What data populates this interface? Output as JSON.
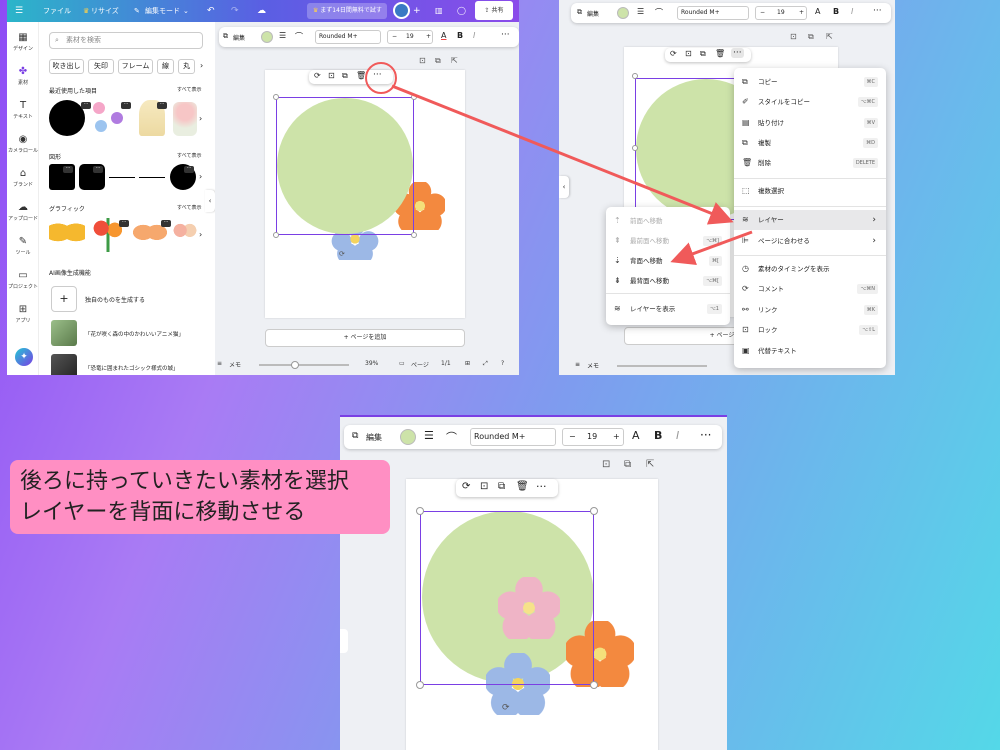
{
  "panel1": {
    "topbar": {
      "file": "ファイル",
      "resize": "リサイズ",
      "edit_mode": "編集モード",
      "trial": "まず14日間無料で試す",
      "share": "共有"
    },
    "sidebar": [
      {
        "icon": "design-icon",
        "label": "デザイン"
      },
      {
        "icon": "elements-icon",
        "label": "素材"
      },
      {
        "icon": "text-icon",
        "label": "テキスト"
      },
      {
        "icon": "camera-roll-icon",
        "label": "カメラロール"
      },
      {
        "icon": "brand-icon",
        "label": "ブランド"
      },
      {
        "icon": "upload-icon",
        "label": "アップロード"
      },
      {
        "icon": "draw-icon",
        "label": "ツール"
      },
      {
        "icon": "folder-icon",
        "label": "プロジェクト"
      },
      {
        "icon": "apps-icon",
        "label": "アプリ"
      }
    ],
    "search_placeholder": "素材を検索",
    "chips": [
      "吹き出し",
      "矢印",
      "フレーム",
      "線",
      "丸"
    ],
    "recent_title": "最近使用した項目",
    "see_all": "すべて表示",
    "shapes_title": "図形",
    "graphics_title": "グラフィック",
    "ai_title": "AI画像生成機能",
    "ai_generate": "独自のものを生成する",
    "ai_items": [
      "「花が咲く森の中のかわいいアニメ猫」",
      "「恐竜に囲まれたゴシック様式の城」"
    ],
    "toolbar": {
      "edit": "編集",
      "font": "Rounded M+",
      "size": "19"
    },
    "add_page": "+ ページを追加",
    "bottom": {
      "memo": "メモ",
      "zoom": "39%",
      "page": "ページ",
      "page_count": "1/1"
    }
  },
  "panel2": {
    "toolbar": {
      "edit": "編集",
      "font": "Rounded M+",
      "size": "19"
    },
    "context_menu": [
      {
        "icon": "copy-icon",
        "label": "コピー",
        "shortcut": "⌘C"
      },
      {
        "icon": "copy-style-icon",
        "label": "スタイルをコピー",
        "shortcut": "⌥⌘C"
      },
      {
        "icon": "paste-icon",
        "label": "貼り付け",
        "shortcut": "⌘V"
      },
      {
        "icon": "duplicate-icon",
        "label": "複製",
        "shortcut": "⌘D"
      },
      {
        "icon": "trash-icon",
        "label": "削除",
        "shortcut": "DELETE"
      },
      {
        "icon": "multi-select-icon",
        "label": "複数選択",
        "shortcut": ""
      },
      {
        "icon": "layers-icon",
        "label": "レイヤー",
        "shortcut": "›"
      },
      {
        "icon": "align-page-icon",
        "label": "ページに合わせる",
        "shortcut": "›"
      },
      {
        "icon": "timing-icon",
        "label": "素材のタイミングを表示",
        "shortcut": ""
      },
      {
        "icon": "comment-icon",
        "label": "コメント",
        "shortcut": "⌥⌘N"
      },
      {
        "icon": "link-icon",
        "label": "リンク",
        "shortcut": "⌘K"
      },
      {
        "icon": "lock-icon",
        "label": "ロック",
        "shortcut": "⌥⇧L"
      },
      {
        "icon": "alt-text-icon",
        "label": "代替テキスト",
        "shortcut": ""
      }
    ],
    "layer_submenu": [
      {
        "label": "前面へ移動",
        "shortcut": "⌘]",
        "disabled": true
      },
      {
        "label": "最前面へ移動",
        "shortcut": "⌥⌘]",
        "disabled": true
      },
      {
        "label": "背面へ移動",
        "shortcut": "⌘[",
        "disabled": false
      },
      {
        "label": "最背面へ移動",
        "shortcut": "⌥⌘[",
        "disabled": false
      },
      {
        "label": "レイヤーを表示",
        "shortcut": "⌥1",
        "disabled": false
      }
    ],
    "add_page": "+ ページを追加",
    "memo": "メモ"
  },
  "panel3": {
    "toolbar": {
      "edit": "編集",
      "font": "Rounded M+",
      "size": "19"
    }
  },
  "caption": {
    "line1": "後ろに持っていきたい素材を選択",
    "line2": "レイヤーを背面に移動させる"
  },
  "colors": {
    "accent": "#7a3fe4",
    "circle": "#cde3a9",
    "arrow": "#f05a5a",
    "caption_bg": "#ff8fc3"
  }
}
